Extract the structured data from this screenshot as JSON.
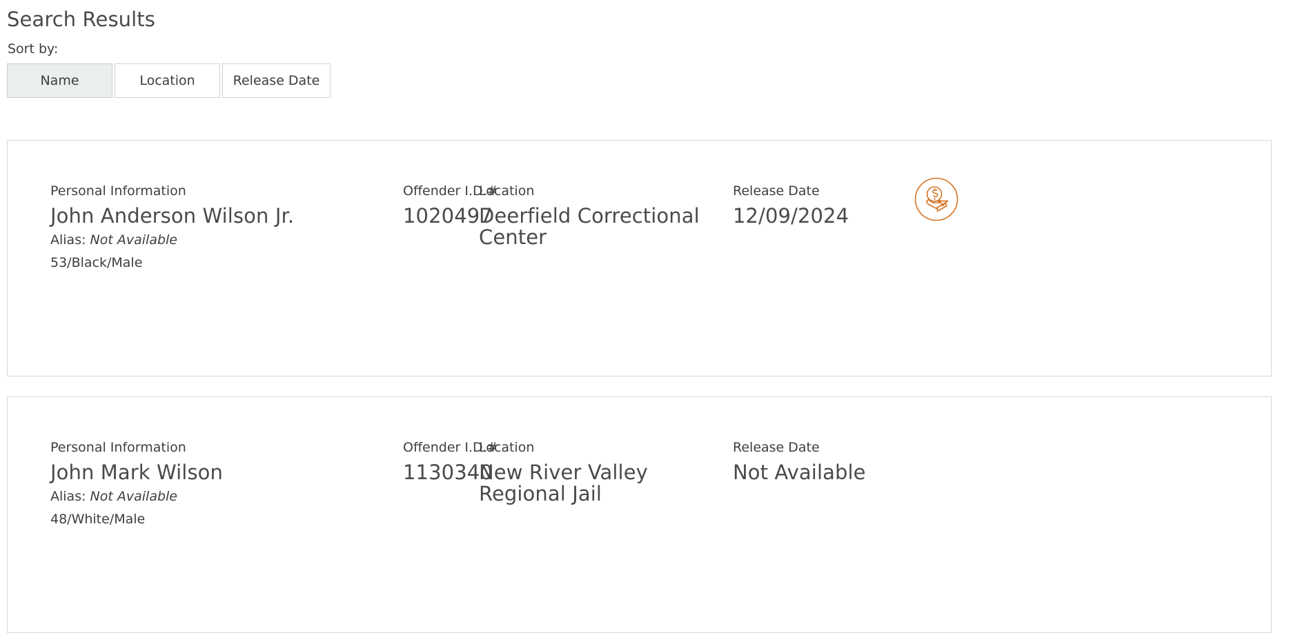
{
  "page": {
    "title": "Search Results"
  },
  "sort": {
    "label": "Sort by:",
    "active": "Name",
    "options": [
      {
        "label": "Name",
        "active": true
      },
      {
        "label": "Location",
        "active": false
      },
      {
        "label": "Release Date",
        "active": false
      }
    ]
  },
  "columns": {
    "personal": "Personal Information",
    "offender_id": "Offender I.D.#",
    "location": "Location",
    "release_date": "Release Date"
  },
  "labels": {
    "alias_prefix": "Alias:"
  },
  "colors": {
    "accent_orange": "#d4711f",
    "text_primary": "#4a4a4a",
    "text_secondary": "#3d3d3d",
    "card_border": "#d7d7d7",
    "button_active_bg": "#ebeeee",
    "button_border": "#cfd4d6"
  },
  "results": [
    {
      "name": "John Anderson Wilson Jr.",
      "alias": "Not Available",
      "demographics": "53/Black/Male",
      "offender_id": "1020497",
      "location": "Deerfield Correctional Center",
      "release_date": "12/09/2024",
      "has_money_icon": true,
      "money_icon_name": "hand-holding-money-icon"
    },
    {
      "name": "John Mark Wilson",
      "alias": "Not Available",
      "demographics": "48/White/Male",
      "offender_id": "1130340",
      "location": "New River Valley Regional Jail",
      "release_date": "Not Available",
      "has_money_icon": false,
      "money_icon_name": ""
    }
  ]
}
